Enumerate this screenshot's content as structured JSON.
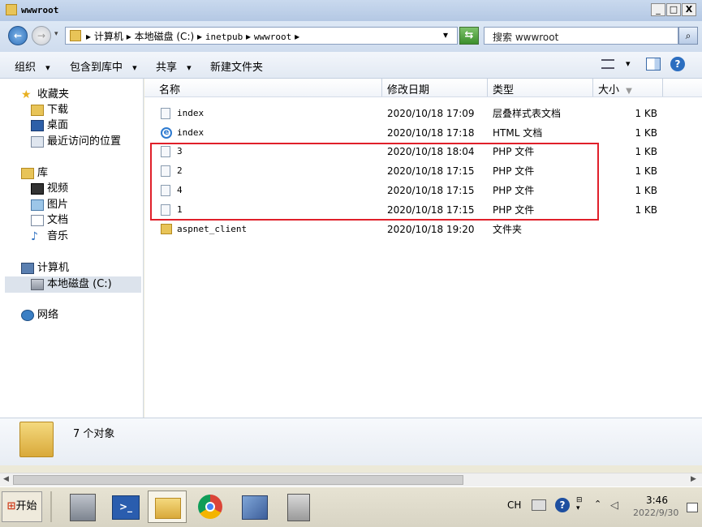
{
  "window": {
    "title": "wwwroot",
    "minimize": "_",
    "maximize": "□",
    "close": "X"
  },
  "address": {
    "segments": [
      "计算机",
      "本地磁盘 (C:)",
      "inetpub",
      "wwwroot"
    ],
    "separator": "▸",
    "dropdown": "▾",
    "search_placeholder": "搜索 wwwroot"
  },
  "toolbar": {
    "organize": "组织",
    "include_library": "包含到库中",
    "share": "共享",
    "new_folder": "新建文件夹",
    "arrow": "▾"
  },
  "nav": {
    "favorites": "收藏夹",
    "downloads": "下载",
    "desktop": "桌面",
    "recent": "最近访问的位置",
    "libraries": "库",
    "videos": "视频",
    "pictures": "图片",
    "documents": "文档",
    "music": "音乐",
    "computer": "计算机",
    "local_disk": "本地磁盘 (C:)",
    "network": "网络"
  },
  "columns": {
    "name": "名称",
    "date": "修改日期",
    "type": "类型",
    "size": "大小"
  },
  "files": [
    {
      "name": "index",
      "date": "2020/10/18 17:09",
      "type": "层叠样式表文档",
      "size": "1 KB",
      "icon": "css-file-icon"
    },
    {
      "name": "index",
      "date": "2020/10/18 17:18",
      "type": "HTML 文档",
      "size": "1 KB",
      "icon": "ie-html-icon"
    },
    {
      "name": "3",
      "date": "2020/10/18 18:04",
      "type": "PHP 文件",
      "size": "1 KB",
      "icon": "php-file-icon"
    },
    {
      "name": "2",
      "date": "2020/10/18 17:15",
      "type": "PHP 文件",
      "size": "1 KB",
      "icon": "php-file-icon"
    },
    {
      "name": "4",
      "date": "2020/10/18 17:15",
      "type": "PHP 文件",
      "size": "1 KB",
      "icon": "php-file-icon"
    },
    {
      "name": "1",
      "date": "2020/10/18 17:15",
      "type": "PHP 文件",
      "size": "1 KB",
      "icon": "php-file-icon"
    },
    {
      "name": "aspnet_client",
      "date": "2020/10/18 19:20",
      "type": "文件夹",
      "size": "",
      "icon": "folder-icon"
    }
  ],
  "details": {
    "count": "7 个对象"
  },
  "taskbar": {
    "start": "开始",
    "lang": "CH",
    "time": "3:46",
    "date": "2022/9/30"
  },
  "colors": {
    "highlight_box": "#e0202a",
    "selected_nav": "#dce3ec"
  }
}
